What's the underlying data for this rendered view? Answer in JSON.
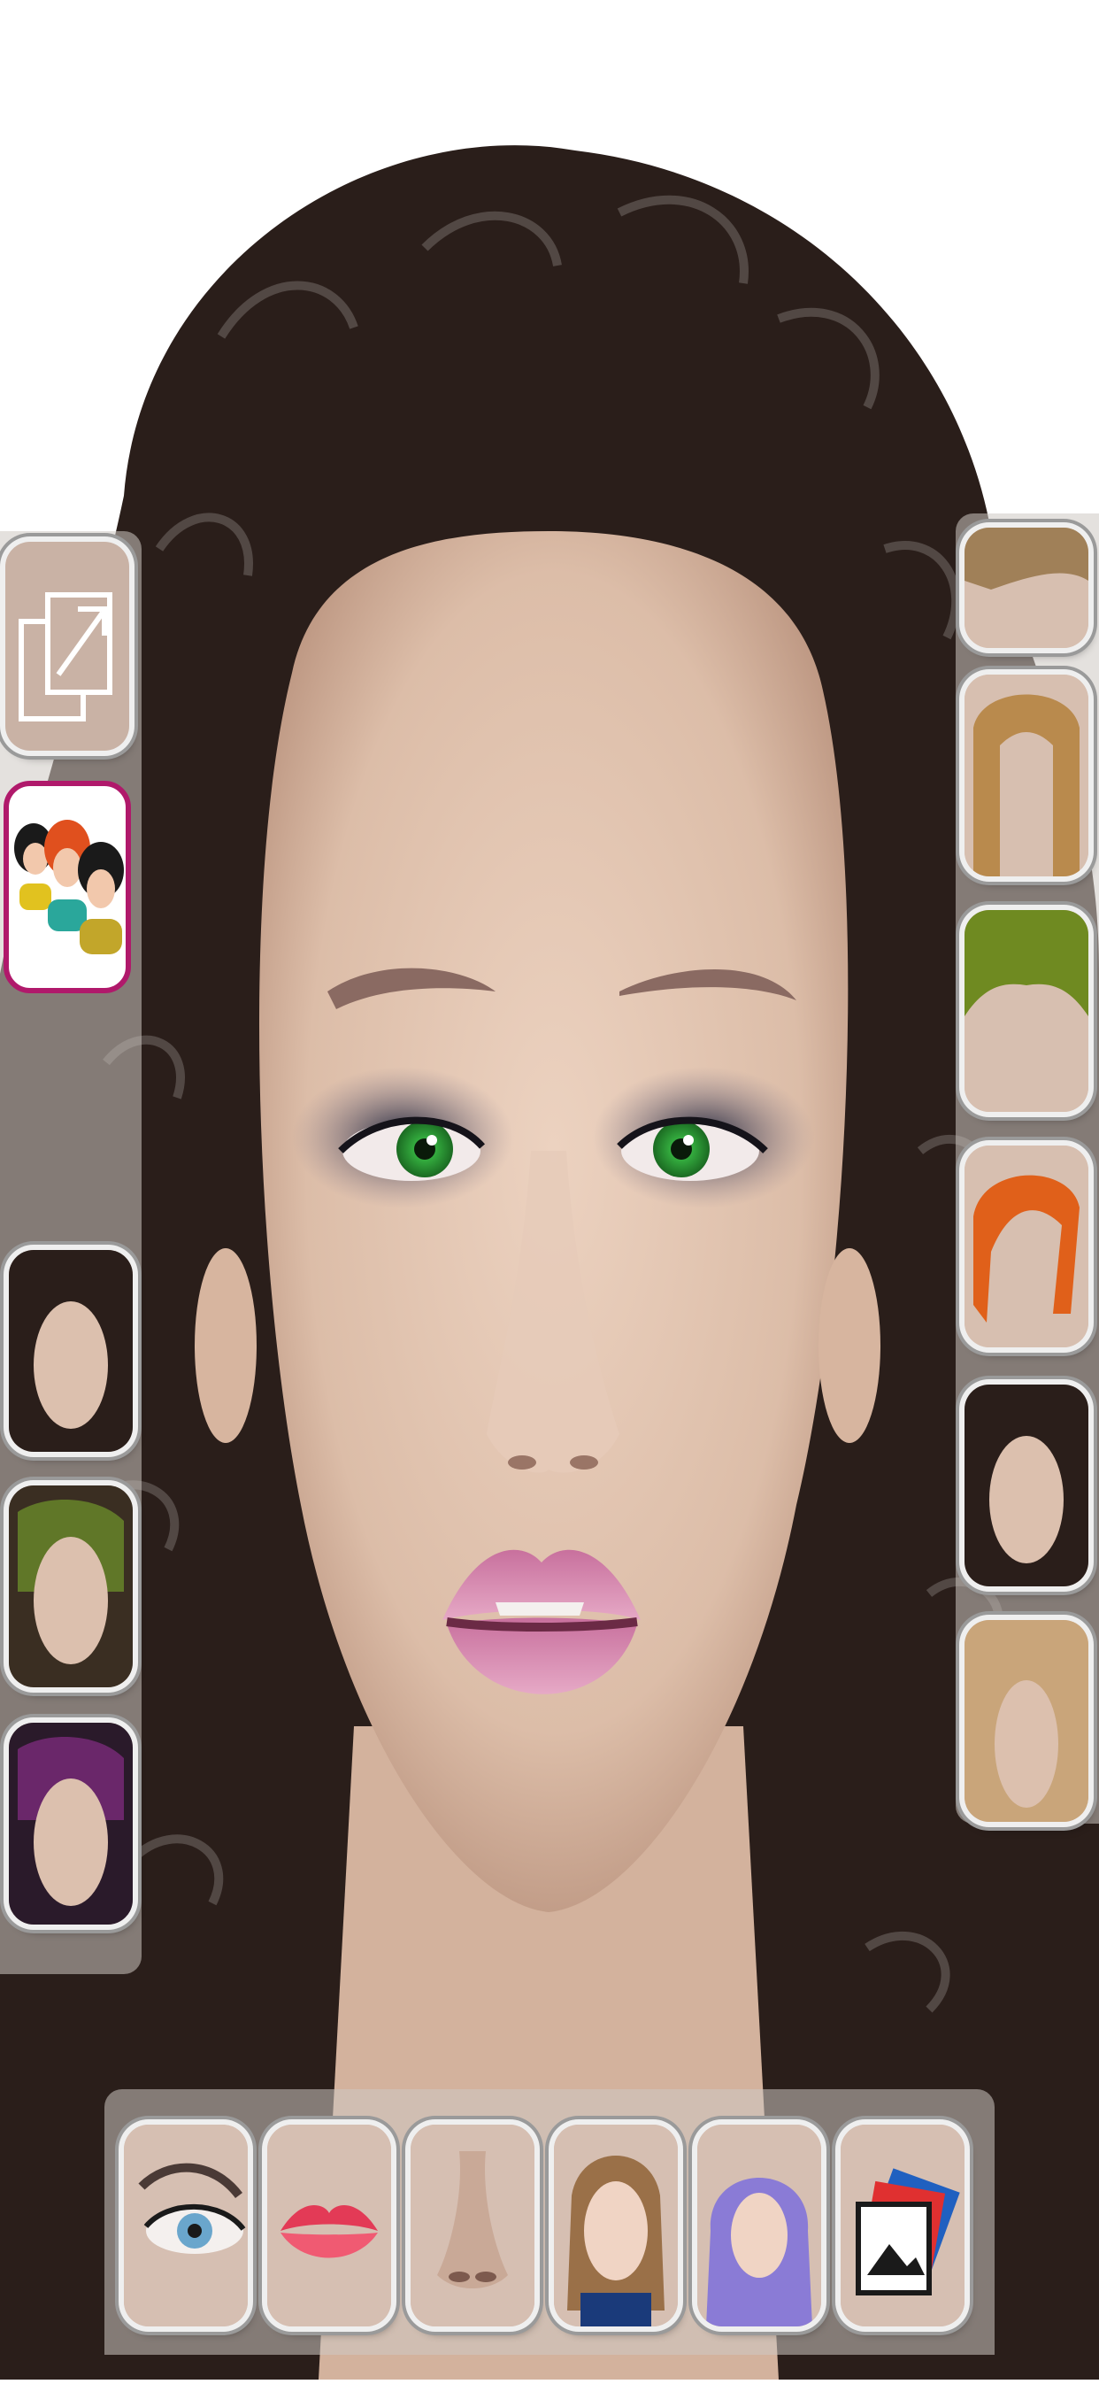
{
  "app": {
    "screen": "face-makeover-editor"
  },
  "left_toolbar": {
    "share_icon": "share-export-icon",
    "group_icon": "people-group-icon",
    "hair_styles": [
      "curly-dark-hair",
      "green-streaked-curly-hair",
      "purple-streaked-curly-hair"
    ]
  },
  "right_toolbar": {
    "hair_styles": [
      "short-blonde-bob-hair",
      "long-blonde-hair",
      "green-spiky-hair",
      "orange-bob-hair",
      "dark-curly-hair",
      "long-light-blonde-hair"
    ]
  },
  "bottom_toolbar": {
    "items": [
      "eyes-icon",
      "lips-icon",
      "nose-icon",
      "makeup-face-icon",
      "hijab-icon",
      "photo-gallery-icon"
    ]
  },
  "colors": {
    "hair": "#2a1e1a",
    "skin": "#e0c2ae",
    "eye": "#2fa53a",
    "lips": "#d98db5",
    "group_border": "#b0196b",
    "tile_bg": "#d6c0b3"
  }
}
